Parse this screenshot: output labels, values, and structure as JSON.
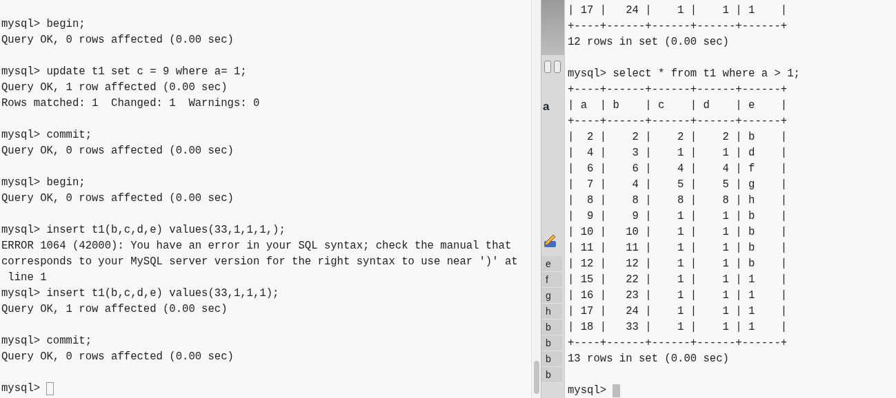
{
  "left_terminal": {
    "focused": false,
    "prompt": "mysql>",
    "blocks": [
      [
        "mysql> begin;",
        "Query OK, 0 rows affected (0.00 sec)"
      ],
      [
        "mysql> update t1 set c = 9 where a= 1;",
        "Query OK, 1 row affected (0.00 sec)",
        "Rows matched: 1  Changed: 1  Warnings: 0"
      ],
      [
        "mysql> commit;",
        "Query OK, 0 rows affected (0.00 sec)"
      ],
      [
        "mysql> begin;",
        "Query OK, 0 rows affected (0.00 sec)"
      ],
      [
        "mysql> insert t1(b,c,d,e) values(33,1,1,1,);",
        "ERROR 1064 (42000): You have an error in your SQL syntax; check the manual that",
        "corresponds to your MySQL server version for the right syntax to use near ')' at",
        " line 1",
        "mysql> insert t1(b,c,d,e) values(33,1,1,1);",
        "Query OK, 1 row affected (0.00 sec)"
      ],
      [
        "mysql> commit;",
        "Query OK, 0 rows affected (0.00 sec)"
      ]
    ]
  },
  "background_window": {
    "label": "a",
    "cells": [
      "e",
      "f",
      "g",
      "h",
      "b",
      "b",
      "b",
      "b"
    ]
  },
  "right_terminal": {
    "focused": true,
    "prompt": "mysql>",
    "blocks": [
      [
        "| 17 |   24 |    1 |    1 | 1    |",
        "+----+------+------+------+------+",
        "12 rows in set (0.00 sec)"
      ],
      [
        "mysql> select * from t1 where a > 1;",
        "+----+------+------+------+------+",
        "| a  | b    | c    | d    | e    |",
        "+----+------+------+------+------+",
        "|  2 |    2 |    2 |    2 | b    |",
        "|  4 |    3 |    1 |    1 | d    |",
        "|  6 |    6 |    4 |    4 | f    |",
        "|  7 |    4 |    5 |    5 | g    |",
        "|  8 |    8 |    8 |    8 | h    |",
        "|  9 |    9 |    1 |    1 | b    |",
        "| 10 |   10 |    1 |    1 | b    |",
        "| 11 |   11 |    1 |    1 | b    |",
        "| 12 |   12 |    1 |    1 | b    |",
        "| 15 |   22 |    1 |    1 | 1    |",
        "| 16 |   23 |    1 |    1 | 1    |",
        "| 17 |   24 |    1 |    1 | 1    |",
        "| 18 |   33 |    1 |    1 | 1    |",
        "+----+------+------+------+------+",
        "13 rows in set (0.00 sec)"
      ]
    ]
  }
}
